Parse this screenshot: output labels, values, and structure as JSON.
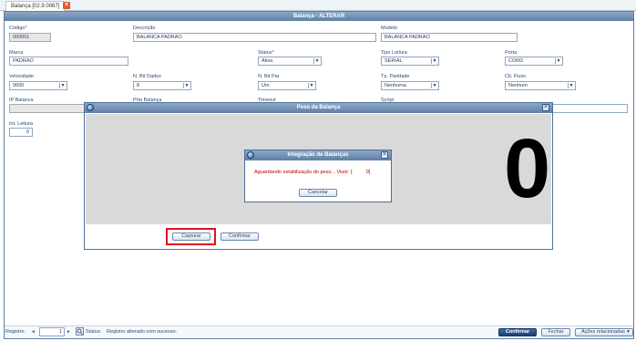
{
  "tab": {
    "label": "Balança [02.9.0067]"
  },
  "window": {
    "title": "Balança - ALTERAR"
  },
  "fields": {
    "codigo": {
      "label": "Código",
      "value": "000001"
    },
    "descricao": {
      "label": "Descrição",
      "value": "BALANCA PADRAO"
    },
    "modelo": {
      "label": "Modelo",
      "value": "BALANCA PADRAO"
    },
    "marca": {
      "label": "Marca",
      "value": "PADRAO"
    },
    "status": {
      "label": "Status",
      "value": "Ativa"
    },
    "tipo_leitura": {
      "label": "Tipo Leitura",
      "value": "SERIAL"
    },
    "porta": {
      "label": "Porta",
      "value": "COM3"
    },
    "velocidade": {
      "label": "Velocidade",
      "value": "9600"
    },
    "bit_dados": {
      "label": "N. Bit Dados",
      "value": "8"
    },
    "bit_par": {
      "label": "N. Bit Par",
      "value": "Um"
    },
    "paridade": {
      "label": "Tp. Paridade",
      "value": "Nenhuma"
    },
    "fluxo": {
      "label": "Ctl. Fluxo",
      "value": "Nenhum"
    },
    "ip": {
      "label": "IP Balanca",
      "value": ""
    },
    "porta_balanca": {
      "label": "Prta Balança"
    },
    "timeout": {
      "label": "Timeout"
    },
    "script": {
      "label": "Script"
    },
    "int_leitura": {
      "label": "Int. Leitura",
      "value": "0"
    }
  },
  "peso_dialog": {
    "title": "Peso da Balança",
    "weight": "0",
    "capture_label": "Capturar",
    "confirm_label": "Confirmar"
  },
  "integracao_dialog": {
    "title": "Integração de Balanças",
    "message": "Aguardando estabilização do peso... Visor: [          0]",
    "cancel_label": "Cancelar"
  },
  "statusbar": {
    "registro_label": "Registro:",
    "page": "1",
    "status_label": "Status:",
    "status_text": "Registro alterado com sucesso.",
    "confirm_label": "Confirmar",
    "close_label": "Fechar",
    "actions_label": "Ações relacionadas"
  },
  "colors": {
    "highlight": "#e0101e",
    "weight_panel_bg": "#d9d9d9"
  }
}
